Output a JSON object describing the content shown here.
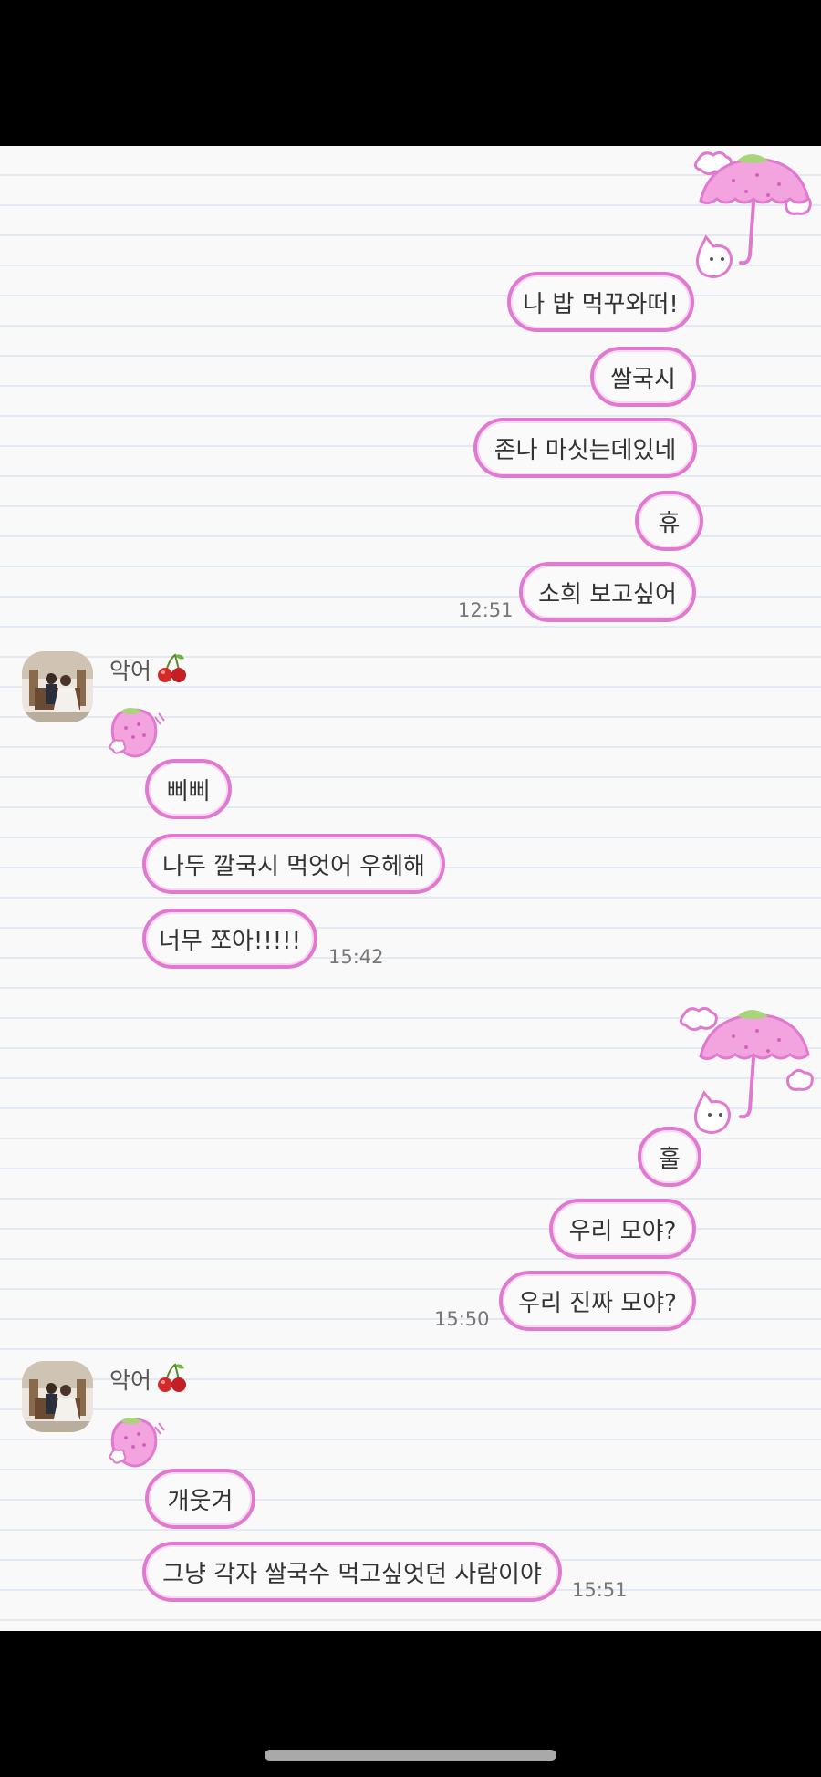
{
  "conversation": {
    "block1": {
      "messages": [
        "나 밥 먹꾸와떠!",
        "쌀국시",
        "존나 마싯는데있네",
        "휴",
        "소희 보고싶어"
      ],
      "time": "12:51"
    },
    "block2": {
      "sender": "악어",
      "messages": [
        "삐삐",
        "나두 깔국시 먹엇어 우헤해",
        "너무 쪼아!!!!!"
      ],
      "time": "15:42"
    },
    "block3": {
      "messages": [
        "훌",
        "우리 모야?",
        "우리 진짜 모야?"
      ],
      "time": "15:50"
    },
    "block4": {
      "sender": "악어",
      "messages": [
        "개웃겨",
        "그냥 각자 쌀국수 먹고싶엇던 사람이야"
      ],
      "time": "15:51"
    }
  },
  "icons": {
    "sender_emoji": "cherry-icon",
    "outgoing_deco": "strawberry-umbrella-cat-icon",
    "incoming_deco": "strawberry-icon"
  },
  "colors": {
    "bubble_border": "#e07ad0",
    "bubble_bg": "#fbfafa",
    "chat_bg": "#faf9f9",
    "line": "#e3e9f2"
  }
}
